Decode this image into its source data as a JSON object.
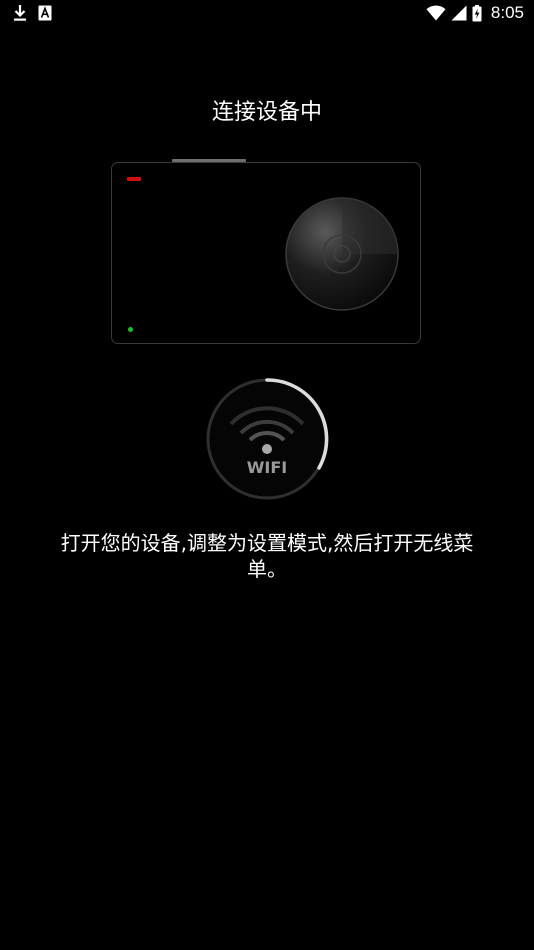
{
  "status_bar": {
    "time": "8:05",
    "icons_left": [
      "download-icon",
      "a-notification-icon"
    ],
    "icons_right": [
      "wifi-icon",
      "signal-icon",
      "battery-icon"
    ]
  },
  "page": {
    "title": "连接设备中",
    "instruction": "打开您的设备,调整为设置模式,然后打开无线菜单。"
  },
  "wifi_badge": {
    "label": "WIFI"
  },
  "colors": {
    "background": "#000000",
    "led_red": "#d01010",
    "led_green": "#1fbf2a",
    "text": "#ffffff"
  }
}
